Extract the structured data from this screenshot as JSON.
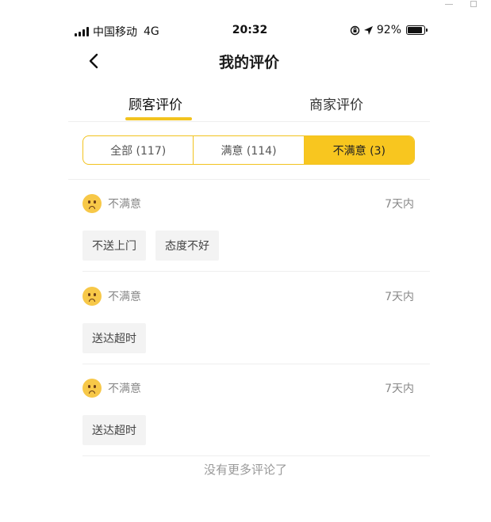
{
  "status_bar": {
    "carrier": "中国移动",
    "network": "4G",
    "time": "20:32",
    "battery": "92%",
    "battery_level": 0.92
  },
  "header": {
    "title": "我的评价",
    "back_icon": "chevron-left-icon"
  },
  "tabs": [
    {
      "label": "顾客评价",
      "active": true
    },
    {
      "label": "商家评价",
      "active": false
    }
  ],
  "filters": [
    {
      "label": "全部 (117)",
      "active": false
    },
    {
      "label": "满意 (114)",
      "active": false
    },
    {
      "label": "不满意 (3)",
      "active": true
    }
  ],
  "reviews": [
    {
      "rating": "不满意",
      "time": "7天内",
      "tags": [
        "不送上门",
        "态度不好"
      ]
    },
    {
      "rating": "不满意",
      "time": "7天内",
      "tags": [
        "送达超时"
      ]
    },
    {
      "rating": "不满意",
      "time": "7天内",
      "tags": [
        "送达超时"
      ]
    }
  ],
  "footer_note": "没有更多评论了",
  "colors": {
    "accent": "#f8c61f",
    "muted_text": "#888888",
    "tag_bg": "#f3f3f3"
  }
}
